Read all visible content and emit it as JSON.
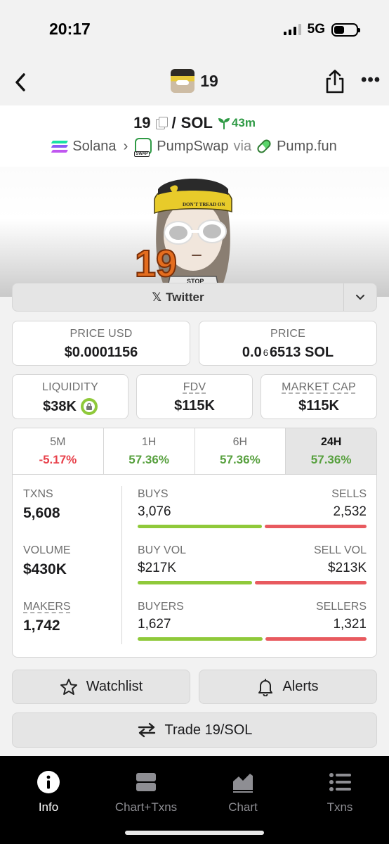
{
  "status_bar": {
    "time": "20:17",
    "network": "5G"
  },
  "nav": {
    "title": "19"
  },
  "pair": {
    "base": "19",
    "separator": "/",
    "quote": "SOL",
    "age": "43m",
    "chain": "Solana",
    "dex": "PumpSwap",
    "via_label": "via",
    "launchpad": "Pump.fun"
  },
  "socials": {
    "twitter_label": "Twitter"
  },
  "prices": {
    "price_usd_label": "PRICE USD",
    "price_usd": "$0.0001156",
    "price_label": "PRICE",
    "price_lead": "0.0",
    "price_zeros": "6",
    "price_tail": "6513 SOL"
  },
  "metrics": {
    "liquidity_label": "LIQUIDITY",
    "liquidity": "$38K",
    "fdv_label": "FDV",
    "fdv": "$115K",
    "mcap_label": "MARKET CAP",
    "mcap": "$115K"
  },
  "timeframes": [
    {
      "label": "5M",
      "change": "-5.17%"
    },
    {
      "label": "1H",
      "change": "57.36%"
    },
    {
      "label": "6H",
      "change": "57.36%"
    },
    {
      "label": "24H",
      "change": "57.36%"
    }
  ],
  "stats": {
    "txns_label": "TXNS",
    "txns": "5,608",
    "volume_label": "VOLUME",
    "volume": "$430K",
    "makers_label": "MAKERS",
    "makers": "1,742",
    "buys_label": "BUYS",
    "buys": "3,076",
    "sells_label": "SELLS",
    "sells": "2,532",
    "buy_vol_label": "BUY VOL",
    "buy_vol": "$217K",
    "sell_vol_label": "SELL VOL",
    "sell_vol": "$213K",
    "buyers_label": "BUYERS",
    "buyers": "1,627",
    "sellers_label": "SELLERS",
    "sellers": "1,321"
  },
  "actions": {
    "watchlist": "Watchlist",
    "alerts": "Alerts",
    "trade": "Trade 19/SOL"
  },
  "tabs": [
    {
      "label": "Info",
      "icon": "info-icon"
    },
    {
      "label": "Chart+Txns",
      "icon": "chart-txns-icon"
    },
    {
      "label": "Chart",
      "icon": "chart-icon"
    },
    {
      "label": "Txns",
      "icon": "list-icon"
    }
  ],
  "colors": {
    "positive": "#57a03e",
    "negative": "#e8414b",
    "buy_bar": "#8fc93a",
    "sell_bar": "#e85a5f"
  }
}
